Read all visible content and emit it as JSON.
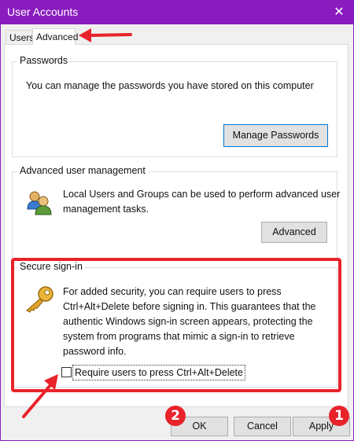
{
  "window": {
    "title": "User Accounts",
    "close_glyph": "✕"
  },
  "tabs": [
    {
      "label": "Users"
    },
    {
      "label": "Advanced"
    }
  ],
  "passwords": {
    "legend": "Passwords",
    "text": "You can manage the passwords you have stored on this computer",
    "button": "Manage Passwords"
  },
  "advanced_mgmt": {
    "legend": "Advanced user management",
    "text_line1": "Local Users and Groups can be used to perform advanced user",
    "text_line2": "management tasks.",
    "button": "Advanced",
    "icon": "users-group-icon"
  },
  "secure_signin": {
    "legend": "Secure sign-in",
    "lines": [
      "For added security, you can require users to press",
      "Ctrl+Alt+Delete before signing in. This guarantees that the",
      "authentic Windows sign-in screen appears, protecting the",
      "system from programs that mimic a sign-in to retrieve",
      "password info."
    ],
    "checkbox_label": "Require users to press Ctrl+Alt+Delete",
    "checkbox_checked": false,
    "icon": "key-icon"
  },
  "footer": {
    "ok": "OK",
    "cancel": "Cancel",
    "apply": "Apply"
  },
  "annotations": {
    "badge_ok": "2",
    "badge_apply": "1",
    "color": "#e8232b"
  },
  "colors": {
    "titlebar": "#8a1cbf",
    "focus_border": "#0078d7"
  }
}
